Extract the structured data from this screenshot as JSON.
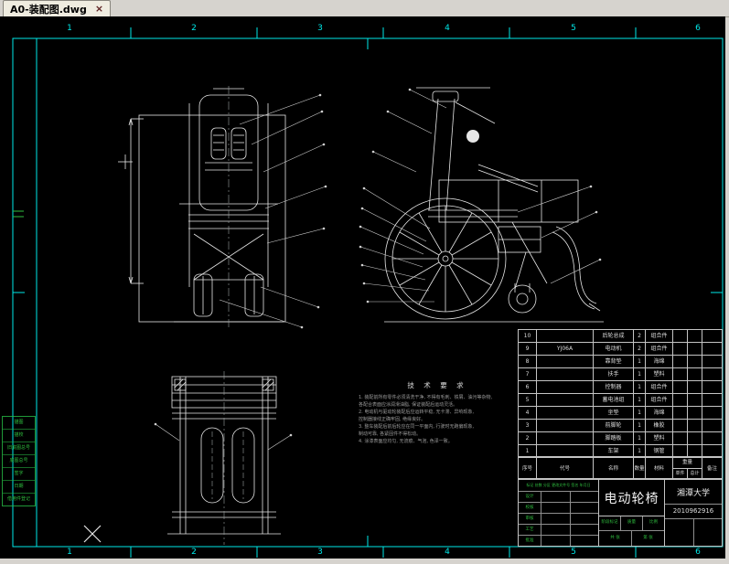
{
  "window": {
    "tab_title": "A0-装配图.dwg",
    "close_glyph": "×"
  },
  "ruler": {
    "top": [
      "1",
      "2",
      "3",
      "4",
      "5",
      "6"
    ],
    "bottom": [
      "1",
      "2",
      "3",
      "4",
      "5",
      "6"
    ]
  },
  "colors": {
    "frame_cyan": "#00e8e8",
    "line_white": "#e6e6e6",
    "annot_green": "#2fbf3f",
    "canvas_bg": "#000000",
    "chrome_bg": "#d6d3ce"
  },
  "tech_notes": {
    "title": "技 术 要 求",
    "lines": [
      "1. 装配前所有零件必须清洗干净, 不得有毛刺、铁屑、油污等杂物,",
      "   各配合表面应涂润滑油脂, 保证装配后运动灵活。",
      "2. 电动机与驱动轮装配后应运转平稳, 无卡滞、异响现象,",
      "   控制器接线正确牢固, 绝缘良好。",
      "3. 整车装配后前后轮应在同一平面内, 行驶时无跑偏现象,",
      "   制动可靠, 各紧固件不得松动。",
      "4. 涂漆表面应均匀, 无流痕、气泡, 色泽一致。"
    ]
  },
  "left_margin": {
    "rows": [
      "描图",
      "描校",
      "旧底图总号",
      "底图总号",
      "签字",
      "日期",
      "借用件登记"
    ]
  },
  "parts_table": {
    "header": {
      "index": "序号",
      "code": "代号",
      "name": "名称",
      "qty": "数量",
      "material": "材料",
      "weight_group": "重量",
      "unit": "单件",
      "total": "总计",
      "remark": "备注"
    },
    "rows": [
      {
        "index": "10",
        "code": "",
        "name": "后轮总成",
        "qty": "2",
        "material": "组合件",
        "remark": ""
      },
      {
        "index": "9",
        "code": "YJ06A",
        "name": "电动机",
        "qty": "2",
        "material": "组合件",
        "remark": ""
      },
      {
        "index": "8",
        "code": "",
        "name": "靠背垫",
        "qty": "1",
        "material": "海绵",
        "remark": ""
      },
      {
        "index": "7",
        "code": "",
        "name": "扶手",
        "qty": "1",
        "material": "塑料",
        "remark": ""
      },
      {
        "index": "6",
        "code": "",
        "name": "控制器",
        "qty": "1",
        "material": "组合件",
        "remark": ""
      },
      {
        "index": "5",
        "code": "",
        "name": "蓄电池组",
        "qty": "1",
        "material": "组合件",
        "remark": ""
      },
      {
        "index": "4",
        "code": "",
        "name": "坐垫",
        "qty": "1",
        "material": "海绵",
        "remark": ""
      },
      {
        "index": "3",
        "code": "",
        "name": "前脚轮",
        "qty": "1",
        "material": "橡胶",
        "remark": ""
      },
      {
        "index": "2",
        "code": "",
        "name": "脚踏板",
        "qty": "1",
        "material": "塑料",
        "remark": ""
      },
      {
        "index": "1",
        "code": "",
        "name": "车架",
        "qty": "1",
        "material": "钢管",
        "remark": ""
      }
    ]
  },
  "title_block": {
    "product_name": "电动轮椅",
    "organization": "湘潭大学",
    "drawing_number": "2010962916",
    "rev_line": "标记 处数 分区 更改文件号 签名 年月日",
    "sign_rows": [
      "设计",
      "校核",
      "审核",
      "工艺",
      "批准"
    ],
    "stage_label": "阶段标记",
    "mass_label": "质量",
    "scale_label": "比例",
    "sheet_total": "共 张",
    "sheet_page": "第 张"
  }
}
